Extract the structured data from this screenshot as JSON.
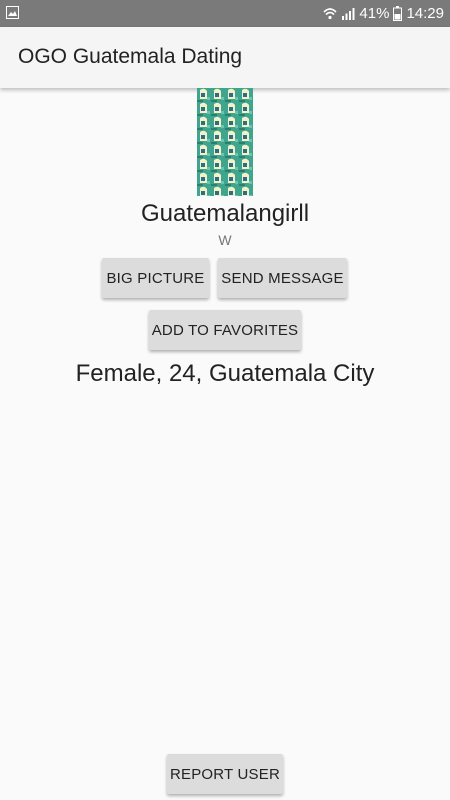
{
  "status_bar": {
    "battery_percent": "41%",
    "time": "14:29",
    "icons": [
      "image-icon",
      "wifi-icon",
      "signal-icon",
      "battery-icon"
    ]
  },
  "app_bar": {
    "title": "OGO Guatemala Dating"
  },
  "profile": {
    "username": "Guatemalangirll",
    "subtext": "W",
    "details": "Female, 24, Guatemala City"
  },
  "buttons": {
    "big_picture": "BIG PICTURE",
    "send_message": "SEND MESSAGE",
    "add_to_favorites": "ADD TO FAVORITES",
    "report_user": "REPORT USER"
  },
  "colors": {
    "status_bar": "#7a7a7a",
    "app_bar": "#f5f5f5",
    "button": "#dcdcdc",
    "background": "#fafafa"
  }
}
